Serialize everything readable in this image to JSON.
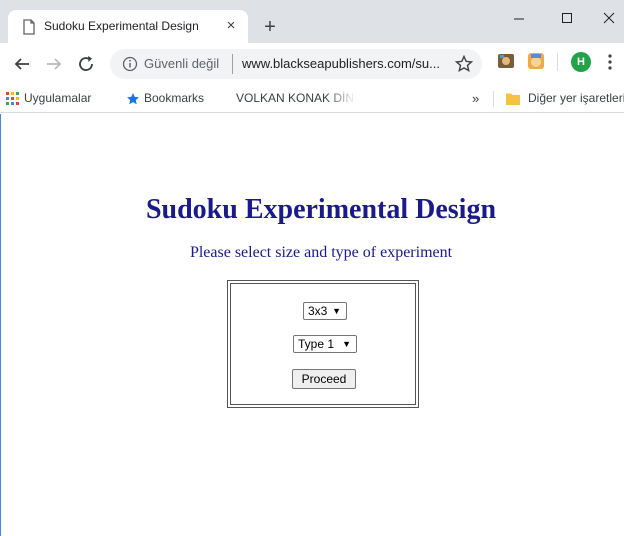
{
  "browser": {
    "tab": {
      "title": "Sudoku Experimental Design",
      "close_glyph": "×"
    },
    "new_tab_glyph": "+",
    "window_controls": {
      "minimize": "–",
      "maximize": "☐",
      "close": "✕"
    },
    "omnibox": {
      "security_label": "Güvenli değil",
      "url": "www.blackseapublishers.com/su..."
    },
    "profile_initial": "H",
    "bookmarks": {
      "apps_label": "Uygulamalar",
      "bookmarks_label": "Bookmarks",
      "volkan_label": "VOLKAN KONAK DİN",
      "more_glyph": "»",
      "other_label": "Diğer yer işaretleri"
    }
  },
  "page": {
    "title": "Sudoku Experimental Design",
    "subtitle": "Please select size and type of experiment",
    "size_select": {
      "selected": "3x3",
      "arrow": "▼"
    },
    "type_select": {
      "selected": "Type 1",
      "arrow": "▼"
    },
    "proceed_label": "Proceed"
  },
  "colors": {
    "heading": "#1a1a8c",
    "chrome_bg": "#dee1e6",
    "profile_avatar": "#22a34a",
    "folder": "#f5c242",
    "star": "#1a73e8"
  }
}
